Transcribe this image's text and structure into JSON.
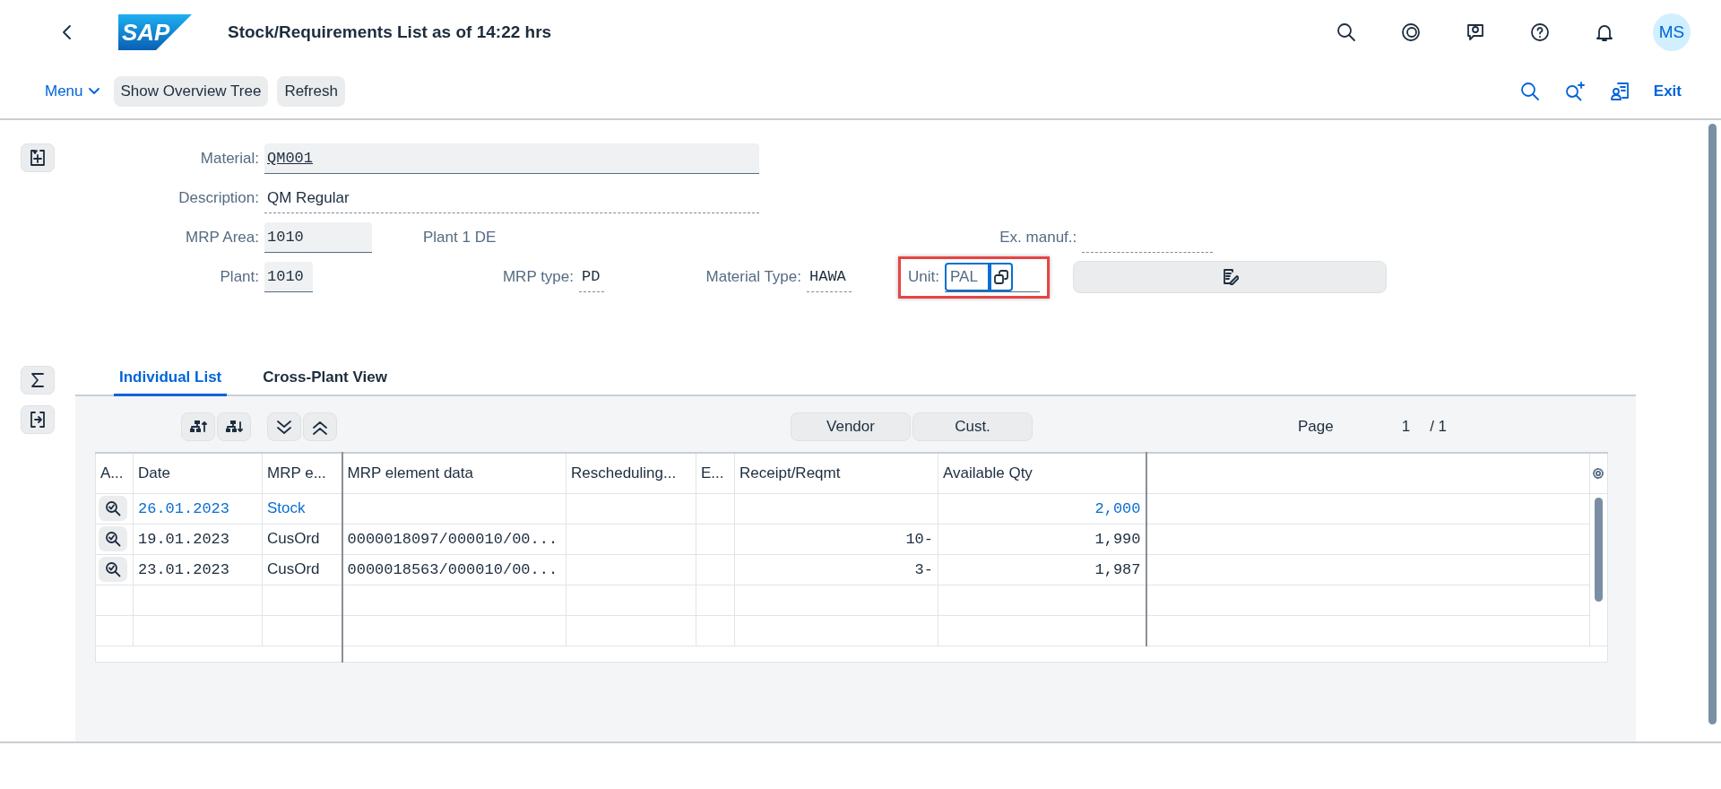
{
  "shell": {
    "logo": "SAP",
    "title": "Stock/Requirements List as of 14:22 hrs",
    "avatar": "MS"
  },
  "toolbar": {
    "menu": "Menu",
    "buttons": [
      "Show Overview Tree",
      "Refresh"
    ],
    "exit": "Exit"
  },
  "form": {
    "rows": [
      [
        {
          "kind": "input",
          "label": "Material:",
          "value": "QM001"
        }
      ],
      [
        {
          "kind": "display",
          "label": "Description:",
          "value": "QM Regular"
        }
      ],
      [
        {
          "kind": "input",
          "label": "MRP Area:",
          "value": "1010"
        },
        {
          "kind": "text",
          "value": "Plant 1 DE"
        },
        {
          "kind": "display",
          "label": "Ex. manuf.:"
        }
      ],
      [
        {
          "kind": "input",
          "label": "Plant:",
          "value": "1010"
        },
        {
          "kind": "display",
          "label": "MRP type:",
          "value": "PD"
        },
        {
          "kind": "display",
          "label": "Material Type:",
          "value": "HAWA"
        },
        {
          "kind": "unit",
          "label": "Unit:",
          "value": "PAL",
          "focused": true,
          "annotated": true
        },
        {
          "kind": "edit_button"
        }
      ]
    ]
  },
  "tabs": [
    {
      "label": "Individual List",
      "selected": true
    },
    {
      "label": "Cross-Plant View",
      "selected": false
    }
  ],
  "table_toolbar": {
    "buttons": [
      "Vendor",
      "Cust."
    ],
    "page_label": "Page",
    "page": "1",
    "page_total": "/ 1"
  },
  "table": {
    "columns": [
      "A...",
      "Date",
      "MRP e...",
      "MRP element data",
      "Rescheduling...",
      "E...",
      "Receipt/Reqmt",
      "Available Qty"
    ],
    "rows": [
      {
        "highlighted": true,
        "date": "26.01.2023",
        "mrp_element": "Stock",
        "available_qty": "2,000"
      },
      {
        "highlighted": false,
        "date": "19.01.2023",
        "mrp_element": "CusOrd",
        "mrp_element_data": "0000018097/000010/00...",
        "receipt_reqmt": "10-",
        "available_qty": "1,990"
      },
      {
        "highlighted": false,
        "date": "23.01.2023",
        "mrp_element": "CusOrd",
        "mrp_element_data": "0000018563/000010/00...",
        "receipt_reqmt": "3-",
        "available_qty": "1,987"
      }
    ]
  }
}
